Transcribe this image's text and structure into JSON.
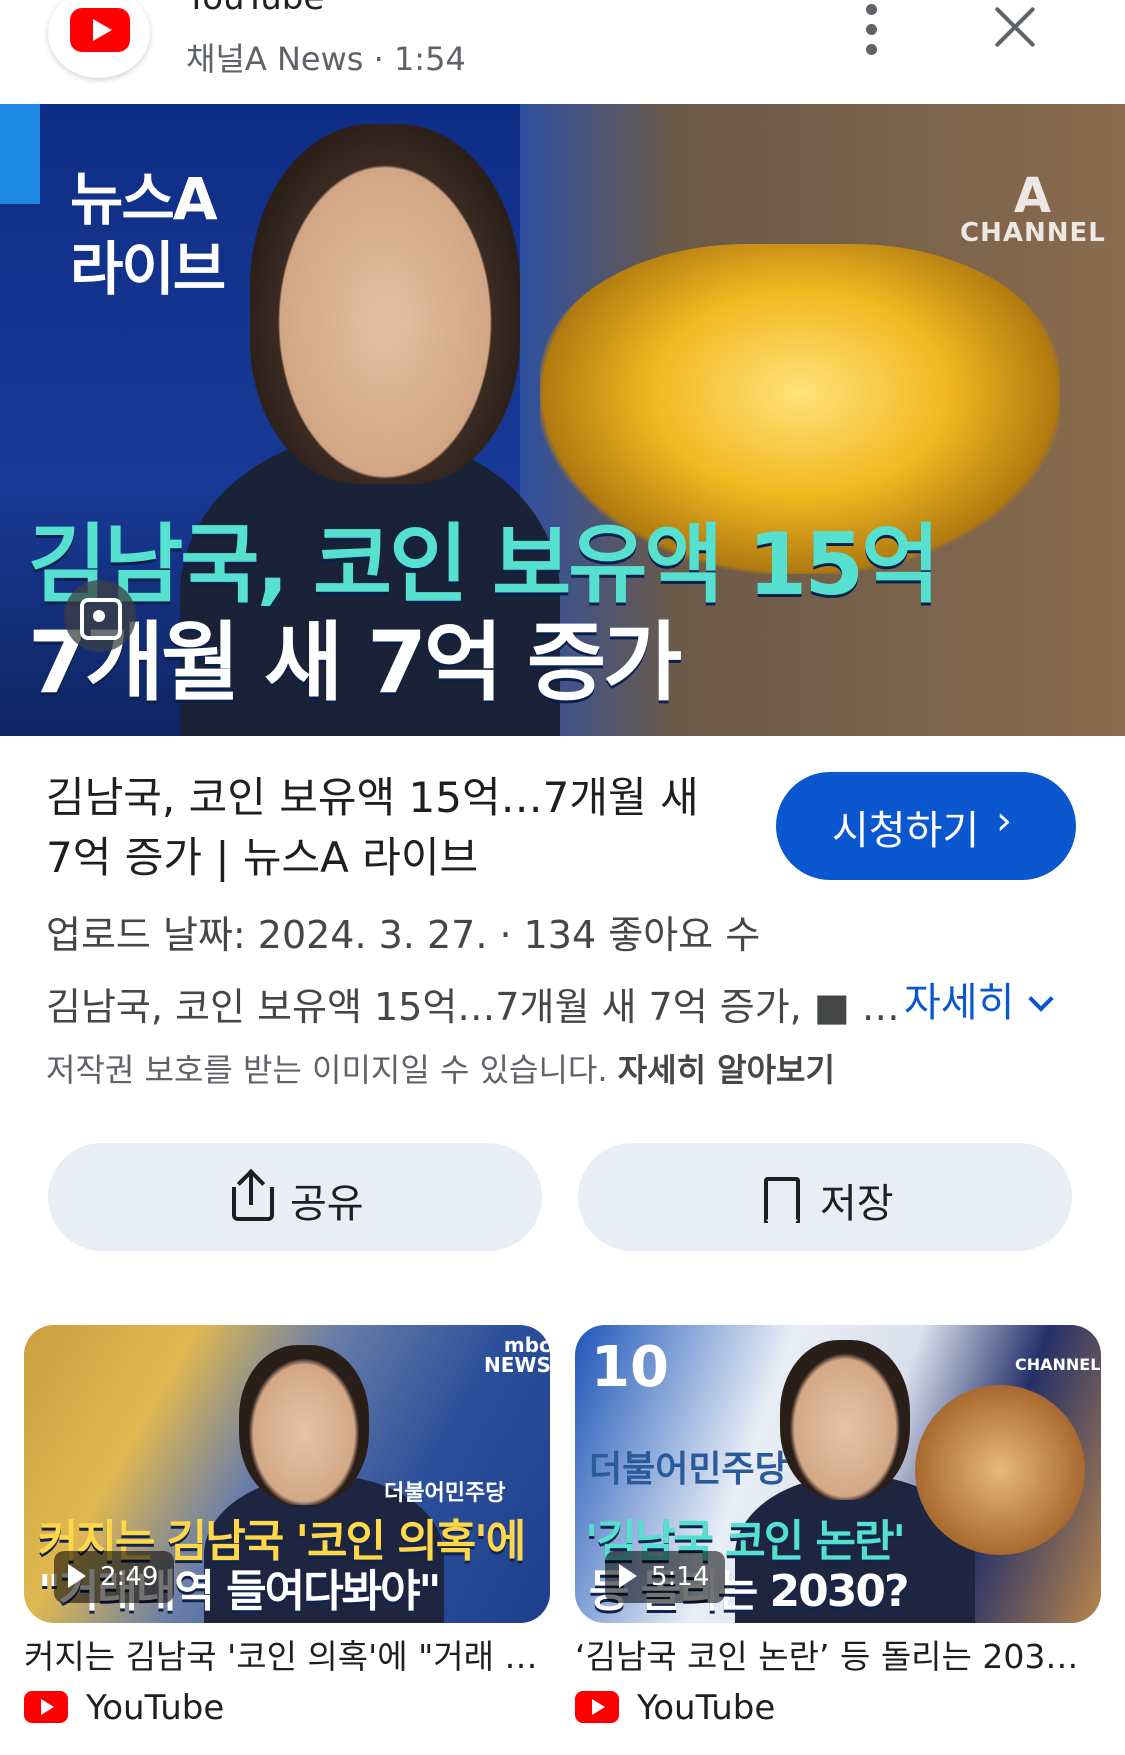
{
  "header": {
    "source_name": "YouTube",
    "channel": "채널A News",
    "separator": "·",
    "duration": "1:54"
  },
  "main_thumbnail": {
    "show_logo_line1": "뉴스A",
    "show_logo_line2": "라이브",
    "channel_logo_mark": "A",
    "channel_logo_text": "CHANNEL",
    "caption_line1": "김남국, 코인 보유액 15억",
    "caption_line2": "7개월 새 7억 증가"
  },
  "info": {
    "title": "김남국, 코인 보유액 15억…7개월 새 7억 증가 | 뉴스A 라이브",
    "watch_label": "시청하기",
    "watch_chevron": "›",
    "upload_line": "업로드 날짜: 2024. 3. 27.  ·  134 좋아요 수",
    "description": "김남국, 코인 보유액 15억…7개월 새 7억 증가, ■ …",
    "more_label": "자세히",
    "copyright_text": "저작권 보호를 받는 이미지일 수 있습니다.",
    "copyright_link": "자세히 알아보기"
  },
  "actions": {
    "share_label": "공유",
    "save_label": "저장"
  },
  "related": [
    {
      "badge_top": "mbc",
      "badge_bottom": "NEWS",
      "party_label": "더불어민주당",
      "overlay_line1": "커지는 김남국 '코인 의혹'에",
      "overlay_line2": "\"거래내역 들여다봐야\"",
      "duration": "2:49",
      "title": "커지는 김남국 '코인 의혹'에 \"거래 …",
      "source": "YouTube"
    },
    {
      "badge_top": "10",
      "badge_bottom": "CHANNEL",
      "party_label": "더불어민주당",
      "overlay_line1": "'김남국 코인 논란'",
      "overlay_line2": "등 돌리는 2030?",
      "duration": "5:14",
      "title": "‘김남국 코인 논란’ 등 돌리는 203…",
      "source": "YouTube"
    }
  ],
  "colors": {
    "accent": "#0b57d0",
    "action_bg": "#e9eef6",
    "youtube_red": "#ff0000",
    "caption_teal": "#56e0d0"
  }
}
